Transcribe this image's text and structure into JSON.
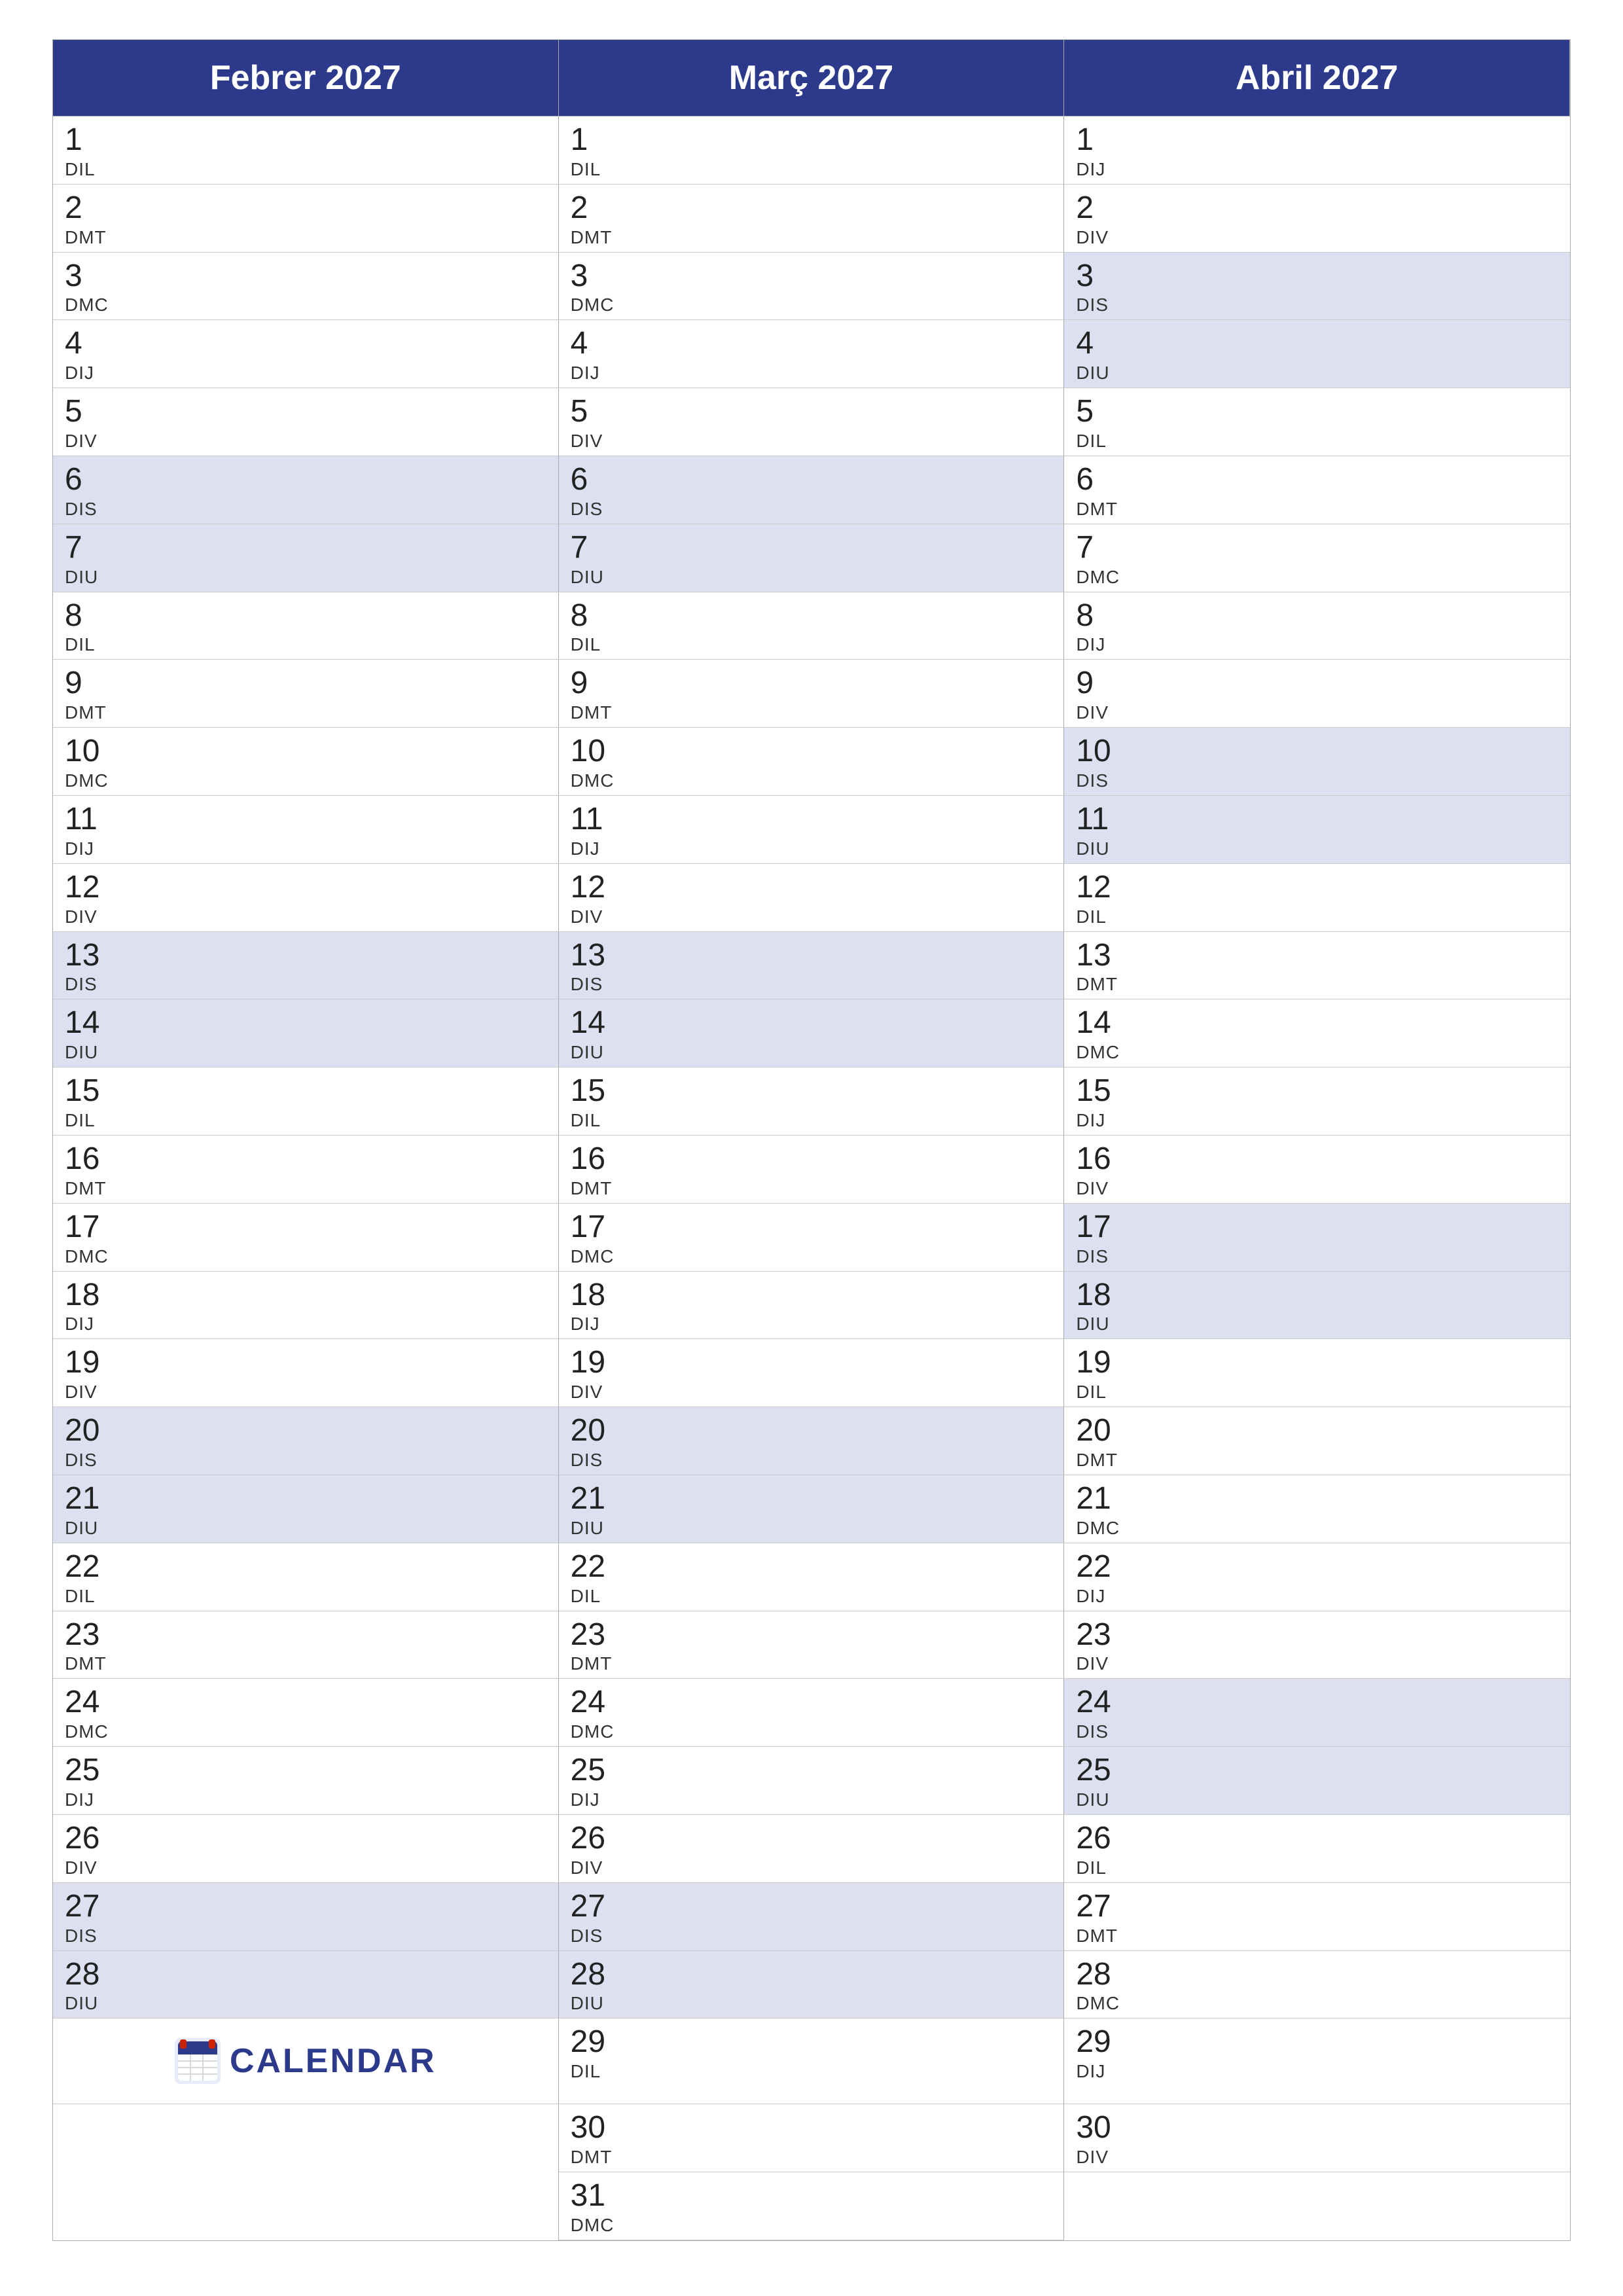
{
  "months": [
    {
      "name": "Febrer 2027",
      "days": [
        {
          "num": "1",
          "name": "DIL",
          "weekend": false
        },
        {
          "num": "2",
          "name": "DMT",
          "weekend": false
        },
        {
          "num": "3",
          "name": "DMC",
          "weekend": false
        },
        {
          "num": "4",
          "name": "DIJ",
          "weekend": false
        },
        {
          "num": "5",
          "name": "DIV",
          "weekend": false
        },
        {
          "num": "6",
          "name": "DIS",
          "weekend": true
        },
        {
          "num": "7",
          "name": "DIU",
          "weekend": true
        },
        {
          "num": "8",
          "name": "DIL",
          "weekend": false
        },
        {
          "num": "9",
          "name": "DMT",
          "weekend": false
        },
        {
          "num": "10",
          "name": "DMC",
          "weekend": false
        },
        {
          "num": "11",
          "name": "DIJ",
          "weekend": false
        },
        {
          "num": "12",
          "name": "DIV",
          "weekend": false
        },
        {
          "num": "13",
          "name": "DIS",
          "weekend": true
        },
        {
          "num": "14",
          "name": "DIU",
          "weekend": true
        },
        {
          "num": "15",
          "name": "DIL",
          "weekend": false
        },
        {
          "num": "16",
          "name": "DMT",
          "weekend": false
        },
        {
          "num": "17",
          "name": "DMC",
          "weekend": false
        },
        {
          "num": "18",
          "name": "DIJ",
          "weekend": false
        },
        {
          "num": "19",
          "name": "DIV",
          "weekend": false
        },
        {
          "num": "20",
          "name": "DIS",
          "weekend": true
        },
        {
          "num": "21",
          "name": "DIU",
          "weekend": true
        },
        {
          "num": "22",
          "name": "DIL",
          "weekend": false
        },
        {
          "num": "23",
          "name": "DMT",
          "weekend": false
        },
        {
          "num": "24",
          "name": "DMC",
          "weekend": false
        },
        {
          "num": "25",
          "name": "DIJ",
          "weekend": false
        },
        {
          "num": "26",
          "name": "DIV",
          "weekend": false
        },
        {
          "num": "27",
          "name": "DIS",
          "weekend": true
        },
        {
          "num": "28",
          "name": "DIU",
          "weekend": true
        }
      ],
      "extra_cells": 3
    },
    {
      "name": "Març 2027",
      "days": [
        {
          "num": "1",
          "name": "DIL",
          "weekend": false
        },
        {
          "num": "2",
          "name": "DMT",
          "weekend": false
        },
        {
          "num": "3",
          "name": "DMC",
          "weekend": false
        },
        {
          "num": "4",
          "name": "DIJ",
          "weekend": false
        },
        {
          "num": "5",
          "name": "DIV",
          "weekend": false
        },
        {
          "num": "6",
          "name": "DIS",
          "weekend": true
        },
        {
          "num": "7",
          "name": "DIU",
          "weekend": true
        },
        {
          "num": "8",
          "name": "DIL",
          "weekend": false
        },
        {
          "num": "9",
          "name": "DMT",
          "weekend": false
        },
        {
          "num": "10",
          "name": "DMC",
          "weekend": false
        },
        {
          "num": "11",
          "name": "DIJ",
          "weekend": false
        },
        {
          "num": "12",
          "name": "DIV",
          "weekend": false
        },
        {
          "num": "13",
          "name": "DIS",
          "weekend": true
        },
        {
          "num": "14",
          "name": "DIU",
          "weekend": true
        },
        {
          "num": "15",
          "name": "DIL",
          "weekend": false
        },
        {
          "num": "16",
          "name": "DMT",
          "weekend": false
        },
        {
          "num": "17",
          "name": "DMC",
          "weekend": false
        },
        {
          "num": "18",
          "name": "DIJ",
          "weekend": false
        },
        {
          "num": "19",
          "name": "DIV",
          "weekend": false
        },
        {
          "num": "20",
          "name": "DIS",
          "weekend": true
        },
        {
          "num": "21",
          "name": "DIU",
          "weekend": true
        },
        {
          "num": "22",
          "name": "DIL",
          "weekend": false
        },
        {
          "num": "23",
          "name": "DMT",
          "weekend": false
        },
        {
          "num": "24",
          "name": "DMC",
          "weekend": false
        },
        {
          "num": "25",
          "name": "DIJ",
          "weekend": false
        },
        {
          "num": "26",
          "name": "DIV",
          "weekend": false
        },
        {
          "num": "27",
          "name": "DIS",
          "weekend": true
        },
        {
          "num": "28",
          "name": "DIU",
          "weekend": true
        },
        {
          "num": "29",
          "name": "DIL",
          "weekend": false
        },
        {
          "num": "30",
          "name": "DMT",
          "weekend": false
        },
        {
          "num": "31",
          "name": "DMC",
          "weekend": false
        }
      ],
      "extra_cells": 0
    },
    {
      "name": "Abril 2027",
      "days": [
        {
          "num": "1",
          "name": "DIJ",
          "weekend": false
        },
        {
          "num": "2",
          "name": "DIV",
          "weekend": false
        },
        {
          "num": "3",
          "name": "DIS",
          "weekend": true
        },
        {
          "num": "4",
          "name": "DIU",
          "weekend": true
        },
        {
          "num": "5",
          "name": "DIL",
          "weekend": false
        },
        {
          "num": "6",
          "name": "DMT",
          "weekend": false
        },
        {
          "num": "7",
          "name": "DMC",
          "weekend": false
        },
        {
          "num": "8",
          "name": "DIJ",
          "weekend": false
        },
        {
          "num": "9",
          "name": "DIV",
          "weekend": false
        },
        {
          "num": "10",
          "name": "DIS",
          "weekend": true
        },
        {
          "num": "11",
          "name": "DIU",
          "weekend": true
        },
        {
          "num": "12",
          "name": "DIL",
          "weekend": false
        },
        {
          "num": "13",
          "name": "DMT",
          "weekend": false
        },
        {
          "num": "14",
          "name": "DMC",
          "weekend": false
        },
        {
          "num": "15",
          "name": "DIJ",
          "weekend": false
        },
        {
          "num": "16",
          "name": "DIV",
          "weekend": false
        },
        {
          "num": "17",
          "name": "DIS",
          "weekend": true
        },
        {
          "num": "18",
          "name": "DIU",
          "weekend": true
        },
        {
          "num": "19",
          "name": "DIL",
          "weekend": false
        },
        {
          "num": "20",
          "name": "DMT",
          "weekend": false
        },
        {
          "num": "21",
          "name": "DMC",
          "weekend": false
        },
        {
          "num": "22",
          "name": "DIJ",
          "weekend": false
        },
        {
          "num": "23",
          "name": "DIV",
          "weekend": false
        },
        {
          "num": "24",
          "name": "DIS",
          "weekend": true
        },
        {
          "num": "25",
          "name": "DIU",
          "weekend": true
        },
        {
          "num": "26",
          "name": "DIL",
          "weekend": false
        },
        {
          "num": "27",
          "name": "DMT",
          "weekend": false
        },
        {
          "num": "28",
          "name": "DMC",
          "weekend": false
        },
        {
          "num": "29",
          "name": "DIJ",
          "weekend": false
        },
        {
          "num": "30",
          "name": "DIV",
          "weekend": false
        }
      ],
      "extra_cells": 1
    }
  ],
  "logo": {
    "text": "CALENDAR",
    "icon": "7"
  }
}
